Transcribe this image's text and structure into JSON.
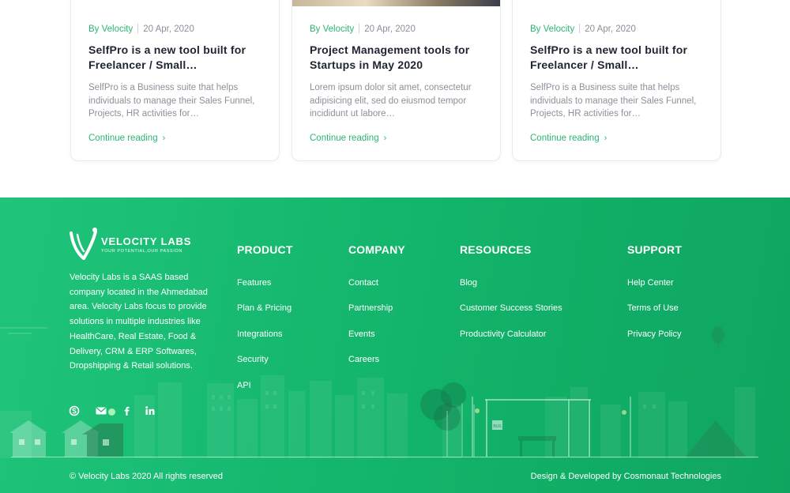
{
  "blog": {
    "cards": [
      {
        "author": "By Velocity",
        "date": "20 Apr, 2020",
        "title": "SelfPro is a new tool built for Freelancer / Small…",
        "excerpt": "SelfPro is a Business suite that helps individuals to manage their Sales Funnel, Projects,  HR activities for…",
        "cta": "Continue reading",
        "has_cover": false
      },
      {
        "author": "By Velocity",
        "date": "20 Apr, 2020",
        "title": "Project Management tools for Startups in May 2020",
        "excerpt": "Lorem ipsum dolor sit amet, consectetur adipisicing elit, sed do eiusmod tempor incididunt ut labore…",
        "cta": "Continue reading",
        "has_cover": true
      },
      {
        "author": "By Velocity",
        "date": "20 Apr, 2020",
        "title": "SelfPro is a new tool built for Freelancer / Small…",
        "excerpt": "SelfPro is a Business suite that helps individuals to manage their Sales Funnel, Projects,  HR activities for…",
        "cta": "Continue reading",
        "has_cover": false
      }
    ]
  },
  "footer": {
    "logo": {
      "brand": "VELOCITY LABS",
      "tagline": "YOUR POTENTIAL,OUR PASSION"
    },
    "about": "Velocity Labs is a SAAS based company located in the Ahmedabad area. Velocity Labs focus to provide solutions in multiple industries like HealthCare, Real Estate, Food & Delivery, CRM & ERP Softwares, Dropshipping & Retail solutions.",
    "columns": {
      "product": {
        "title": "PRODUCT",
        "links": [
          "Features",
          "Plan & Pricing",
          "Integrations",
          "Security",
          "API"
        ]
      },
      "company": {
        "title": "COMPANY",
        "links": [
          "Contact",
          "Partnership",
          "Events",
          "Careers"
        ]
      },
      "resources": {
        "title": "RESOURCES",
        "links": [
          "Blog",
          "Customer Success Stories",
          "Productivity Calculator"
        ]
      },
      "support": {
        "title": "SUPPORT",
        "links": [
          "Help Center",
          "Terms of Use",
          "Privacy Policy"
        ]
      }
    },
    "social": [
      {
        "icon": "skype-icon",
        "glyph": "S"
      },
      {
        "icon": "email-icon",
        "glyph": "✉"
      },
      {
        "icon": "facebook-icon",
        "glyph": "f"
      },
      {
        "icon": "linkedin-icon",
        "glyph": "in"
      }
    ],
    "bus_stop_sign": "BUS",
    "copyright": "© Velocity Labs 2020 All rights reserved",
    "credit": "Design & Developed by Cosmonaut Technologies"
  },
  "colors": {
    "accent": "#2bb673",
    "footer_start": "#1fc47a",
    "footer_end": "#0fa560"
  }
}
